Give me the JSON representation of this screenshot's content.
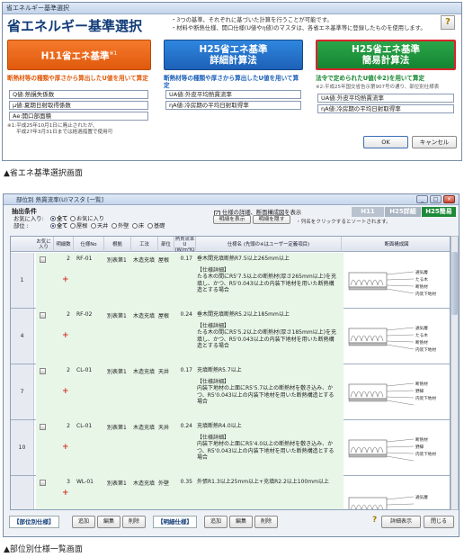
{
  "window1": {
    "title": "省エネルギー基準選択",
    "heading": "省エネルギー基準選択",
    "description_lines": [
      "・3つの基準、それぞれに基づいた計算を行うことが可能です。",
      "・材料や断熱仕様、開口仕様(U値やη値)のマスタは、各省エネ基準等に登録したものを使用します。"
    ],
    "help_label": "?",
    "options": [
      {
        "label": "H11省エネ基準",
        "sup": "※1",
        "note": "断熱材等の種類や厚さから算出したU値を用いて算定",
        "fields": [
          "Q値:熱損失係数",
          "μ値:夏期日射取得係数",
          "Ae:開口部面積"
        ]
      },
      {
        "label_line1": "H25省エネ基準",
        "label_line2": "詳細計算法",
        "note": "断熱材等の種類や厚さから算出したU値を用いて算定",
        "fields": [
          "UA値:外皮平均熱貫流率",
          "ηA値:冷房期の平均日射取得率"
        ]
      },
      {
        "label_line1": "H25省エネ基準",
        "label_line2": "簡易計算法",
        "note": "法令で定められたU値(※2)を用いて算定",
        "sub": "※2:平成25年国交省告示第907号の通り、部位別仕様表",
        "fields": [
          "UA値:外皮平均熱貫流率",
          "ηA値:冷房期の平均日射取得率"
        ]
      }
    ],
    "footnote_lines": [
      "※1:平成25年10月1日に廃止されたが、",
      "平成27年3月31日までは経過措置で使用可"
    ],
    "ok_label": "OK",
    "cancel_label": "キャンセル"
  },
  "caption1": "▲省エネ基準選択画面",
  "window2": {
    "title": "部位別 熱貫流率(U)マスタ [一覧]",
    "controls": [
      "_",
      "□",
      "×"
    ],
    "filter_label": "抽出条件",
    "fav_label": "お気に入り:",
    "fav_options": [
      {
        "label": "全て",
        "selected": true
      },
      {
        "label": "お気に入り",
        "selected": false
      }
    ],
    "site_label": "部位  :",
    "site_options": [
      {
        "label": "全て",
        "selected": true
      },
      {
        "label": "屋根",
        "selected": false
      },
      {
        "label": "天井",
        "selected": false
      },
      {
        "label": "外壁",
        "selected": false
      },
      {
        "label": "床",
        "selected": false
      },
      {
        "label": "基礎",
        "selected": false
      }
    ],
    "spec_checkbox": "仕様の詳細、断面構成図を表示",
    "expand_label": "明細を表示",
    "collapse_label": "明細を隠す",
    "sort_hint": "・列名をクリックするとソートされます。",
    "modes": [
      "H11",
      "H25詳細",
      "H25簡易"
    ],
    "columns": [
      "お気に入り",
      "明細数",
      "仕様No",
      "根拠",
      "工法",
      "部位",
      "熱貫流率 U (W/m²K)",
      "仕様名 (先頭の※はユーザー定義項目)",
      "断面構成図"
    ],
    "rows": [
      {
        "idx": "1",
        "count": "2",
        "no": "RF-01",
        "basis": "別表第1",
        "method": "木造充填",
        "part": "屋根",
        "u": "0.17",
        "name": "垂木間充填断熱R7.5以上265mm以上",
        "detail_title": "【仕様詳細】",
        "detail": "たる木の間にR5'7.5以上の断熱材(厚さ265mm以上)を充填し、かつ、R5'0.043以上の内装下地材を用いた断熱構造とする場合",
        "layers": [
          "通気層",
          "たる木",
          "断熱材",
          "内装下地材"
        ]
      },
      {
        "idx": "4",
        "count": "2",
        "no": "RF-02",
        "basis": "別表第1",
        "method": "木造充填",
        "part": "屋根",
        "u": "0.24",
        "name": "垂木間充填断熱R5.2以上185mm以上",
        "detail_title": "【仕様詳細】",
        "detail": "たる木の間にR5'5.2以上の断熱材(厚さ185mm以上)を充填し、かつ、R5'0.043以上の内装下地材を用いた断熱構造とする場合",
        "layers": [
          "通気層",
          "たる木",
          "断熱材",
          "内装下地材"
        ]
      },
      {
        "idx": "7",
        "count": "2",
        "no": "CL-01",
        "basis": "別表第1",
        "method": "木造充填",
        "part": "天井",
        "u": "0.17",
        "name": "充填断熱R5.7以上",
        "detail_title": "【仕様詳細】",
        "detail": "内装下地材の上面にR5'5.7以上の断熱材を敷き込み、かつ、R5'0.043以上の内装下地材を用いた断熱構造とする場合",
        "layers": [
          "断熱材",
          "野縁",
          "内装下地材"
        ]
      },
      {
        "idx": "10",
        "count": "2",
        "no": "CL-01",
        "basis": "別表第1",
        "method": "木造充填",
        "part": "天井",
        "u": "0.24",
        "name": "充填断熱R4.0以上",
        "detail_title": "【仕様詳細】",
        "detail": "内装下地材の上面にR5'4.0以上の断熱材を敷き込み、かつ、R5'0.043以上の内装下地材を用いた断熱構造とする場合",
        "layers": [
          "断熱材",
          "野縁",
          "内装下地材"
        ]
      },
      {
        "idx": "",
        "count": "3",
        "no": "WL-01",
        "basis": "別表第1",
        "method": "木造充填",
        "part": "外壁",
        "u": "0.35",
        "name": "外張R1.3以上25mm以上+充填R2.2以上100mm以上",
        "detail_title": "",
        "detail": "",
        "layers": [
          "通気層"
        ]
      }
    ],
    "group1_label": "【部位別仕様】",
    "group2_label": "【明細仕様】",
    "add_label": "追加",
    "edit_label": "編集",
    "delete_label": "削除",
    "help_label": "?",
    "detail_view_label": "詳細表示",
    "close_label": "閉じる"
  },
  "caption2": "▲部位別仕様一覧画面"
}
